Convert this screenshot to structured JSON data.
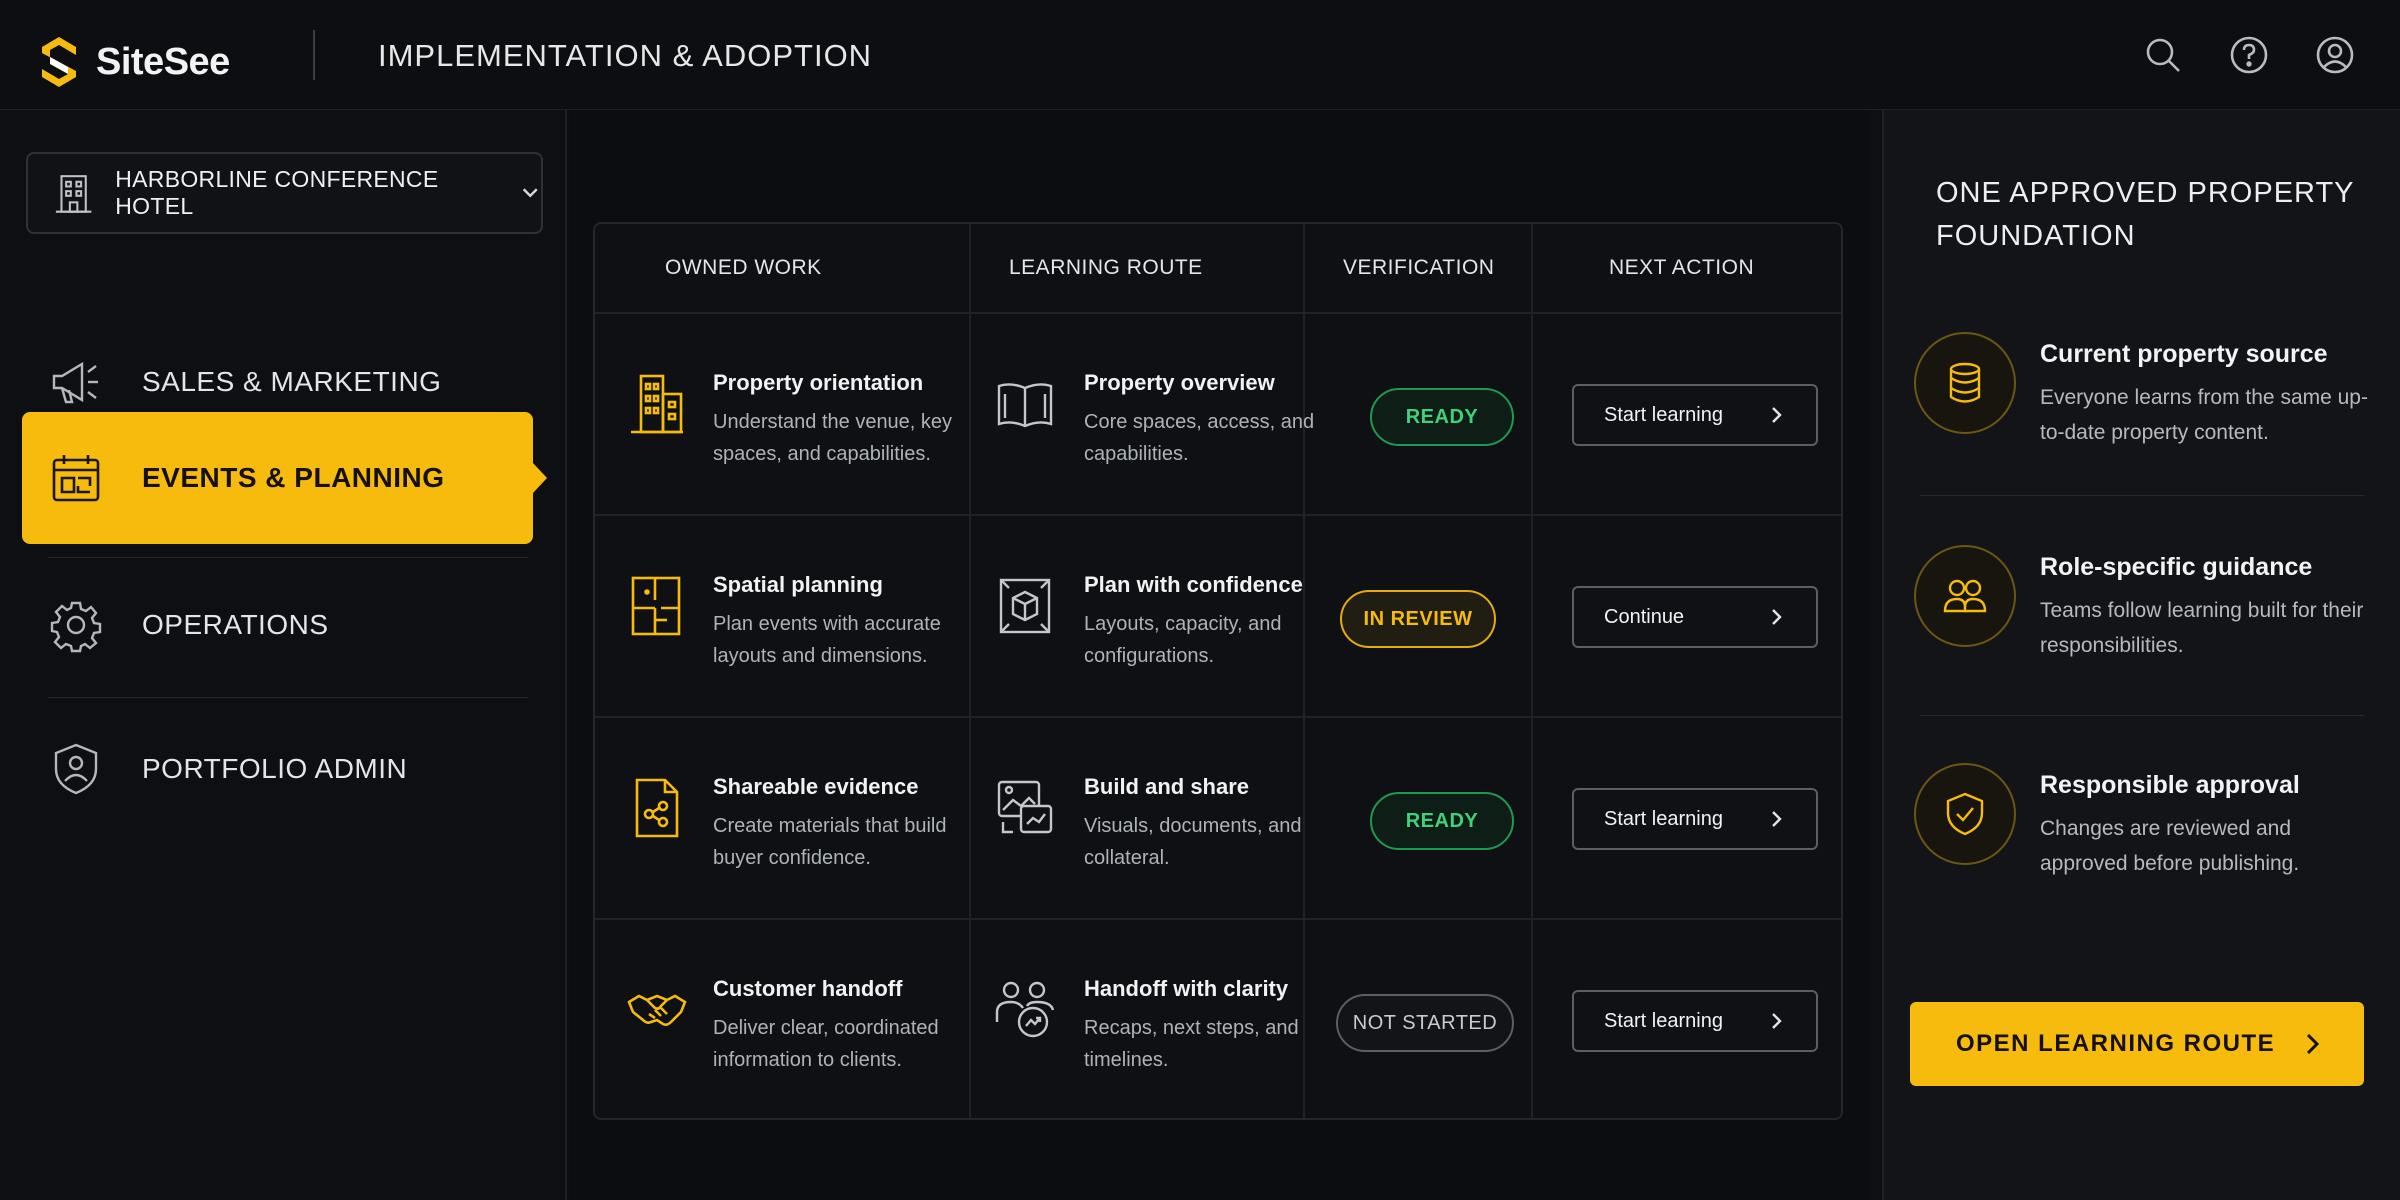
{
  "app": {
    "name": "SiteSee",
    "page_title": "IMPLEMENTATION & ADOPTION",
    "header_icons": [
      "search-icon",
      "help-icon",
      "account-icon"
    ],
    "accent_color": "#f6bb0d"
  },
  "sidebar": {
    "property": {
      "label": "HARBORLINE CONFERENCE HOTEL",
      "icon": "building-icon"
    },
    "items": [
      {
        "label": "SALES & MARKETING",
        "icon": "megaphone-icon",
        "active": false
      },
      {
        "label": "EVENTS & PLANNING",
        "icon": "calendar-icon",
        "active": true
      },
      {
        "label": "OPERATIONS",
        "icon": "gear-icon",
        "active": false
      },
      {
        "label": "PORTFOLIO ADMIN",
        "icon": "shield-user-icon",
        "active": false
      }
    ]
  },
  "table": {
    "columns": [
      "OWNED WORK",
      "LEARNING ROUTE",
      "VERIFICATION",
      "NEXT ACTION"
    ],
    "rows": [
      {
        "work_title": "Property orientation",
        "work_desc": "Understand the venue, key spaces, and capabilities.",
        "work_icon": "building-icon",
        "route_title": "Property overview",
        "route_desc": "Core spaces, access, and capabilities.",
        "route_icon": "book-icon",
        "status": "READY",
        "status_color": "#3fd27a",
        "action": "Start learning"
      },
      {
        "work_title": "Spatial planning",
        "work_desc": "Plan events with accurate layouts and dimensions.",
        "work_icon": "floorplan-icon",
        "route_title": "Plan with confidence",
        "route_desc": "Layouts, capacity, and configurations.",
        "route_icon": "cube-icon",
        "status": "IN REVIEW",
        "status_color": "#f6bb0d",
        "action": "Continue"
      },
      {
        "work_title": "Shareable evidence",
        "work_desc": "Create materials that build buyer confidence.",
        "work_icon": "share-document-icon",
        "route_title": "Build and share",
        "route_desc": "Visuals, documents, and collateral.",
        "route_icon": "image-share-icon",
        "status": "READY",
        "status_color": "#3fd27a",
        "action": "Start learning"
      },
      {
        "work_title": "Customer handoff",
        "work_desc": "Deliver clear, coordinated information to clients.",
        "work_icon": "handshake-icon",
        "route_title": "Handoff with clarity",
        "route_desc": "Recaps, next steps, and timelines.",
        "route_icon": "people-exchange-icon",
        "status": "NOT STARTED",
        "status_color": "#c8ccd2",
        "action": "Start learning"
      }
    ]
  },
  "right_panel": {
    "title": "ONE APPROVED PROPERTY FOUNDATION",
    "features": [
      {
        "title": "Current property source",
        "desc": "Everyone learns from the same up-to-date property content.",
        "icon": "database-icon"
      },
      {
        "title": "Role-specific guidance",
        "desc": "Teams follow learning built for their responsibilities.",
        "icon": "users-icon"
      },
      {
        "title": "Responsible approval",
        "desc": "Changes are reviewed and approved before publishing.",
        "icon": "shield-check-icon"
      }
    ],
    "cta_label": "OPEN LEARNING ROUTE"
  }
}
